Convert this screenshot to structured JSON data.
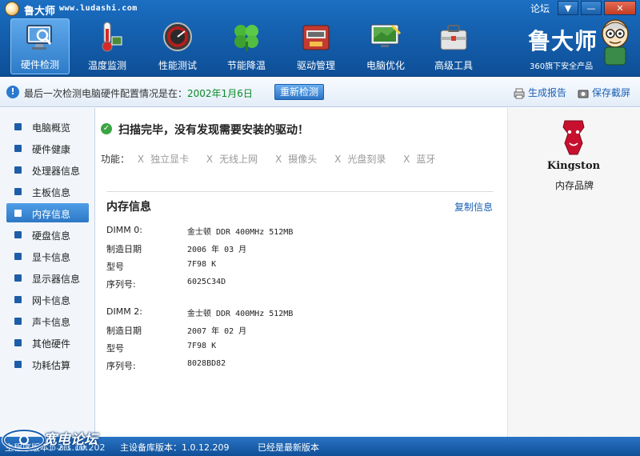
{
  "app": {
    "title": "鲁大师",
    "url": "www.ludashi.com",
    "forum_link": "论坛"
  },
  "toolbar": {
    "items": [
      {
        "label": "硬件检测",
        "icon": "monitor-magnifier-icon",
        "active": true
      },
      {
        "label": "温度监测",
        "icon": "thermometer-icon",
        "active": false
      },
      {
        "label": "性能测试",
        "icon": "speedometer-icon",
        "active": false
      },
      {
        "label": "节能降温",
        "icon": "clover-icon",
        "active": false
      },
      {
        "label": "驱动管理",
        "icon": "toolbox-icon",
        "active": false
      },
      {
        "label": "电脑优化",
        "icon": "optimize-monitor-icon",
        "active": false
      },
      {
        "label": "高级工具",
        "icon": "tool-case-icon",
        "active": false
      }
    ]
  },
  "brand": {
    "name": "鲁大师",
    "subtitle": "360旗下安全产品"
  },
  "infobar": {
    "message": "最后一次检测电脑硬件配置情况是在：",
    "date": "2002年1月6日",
    "recheck_label": "重新检测",
    "report_label": "生成报告",
    "screenshot_label": "保存截屏"
  },
  "sidebar": {
    "items": [
      {
        "label": "电脑概览",
        "active": false
      },
      {
        "label": "硬件健康",
        "active": false
      },
      {
        "label": "处理器信息",
        "active": false
      },
      {
        "label": "主板信息",
        "active": false
      },
      {
        "label": "内存信息",
        "active": true
      },
      {
        "label": "硬盘信息",
        "active": false
      },
      {
        "label": "显卡信息",
        "active": false
      },
      {
        "label": "显示器信息",
        "active": false
      },
      {
        "label": "网卡信息",
        "active": false
      },
      {
        "label": "声卡信息",
        "active": false
      },
      {
        "label": "其他硬件",
        "active": false
      },
      {
        "label": "功耗估算",
        "active": false
      }
    ]
  },
  "main": {
    "scan_result": "扫描完毕，没有发现需要安装的驱动！",
    "features_label": "功能：",
    "features": [
      "独立显卡",
      "无线上网",
      "摄像头",
      "光盘刻录",
      "蓝牙"
    ],
    "feature_missing_mark": "X",
    "section_title": "内存信息",
    "copy_label": "复制信息",
    "dimms": [
      {
        "rows": [
          {
            "k": "DIMM 0:",
            "v": "金士顿 DDR 400MHz 512MB"
          },
          {
            "k": "制造日期",
            "v": "2006 年 03 月"
          },
          {
            "k": "型号",
            "v": "7F98 K"
          },
          {
            "k": "序列号:",
            "v": "6025C34D"
          }
        ]
      },
      {
        "rows": [
          {
            "k": "DIMM 2:",
            "v": "金士顿 DDR 400MHz 512MB"
          },
          {
            "k": "制造日期",
            "v": "2007 年 02 月"
          },
          {
            "k": "型号",
            "v": "7F98 K"
          },
          {
            "k": "序列号:",
            "v": "8028BD82"
          }
        ]
      }
    ]
  },
  "rightpanel": {
    "brand_logo_text": "Kingston",
    "brand_label": "内存品牌"
  },
  "statusbar": {
    "main_version": "主程序版本：2.1.10.202",
    "db_version": "主设备库版本：1.0.12.209",
    "latest": "已经是最新版本",
    "watermark": "宽电论坛",
    "watermark_sub": "JD-BBS.COM"
  },
  "colors": {
    "title_blue": "#1664b4",
    "accent_blue": "#2d78c6",
    "ok_green": "#3aa543",
    "date_green": "#0a8a2a",
    "link_blue": "#1a5fb4"
  }
}
